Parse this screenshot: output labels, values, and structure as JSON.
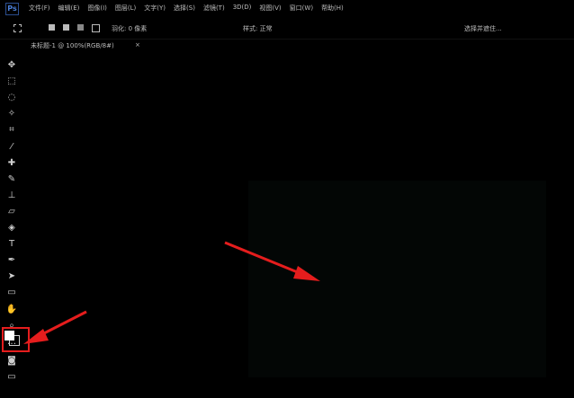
{
  "app": {
    "logo": "Ps"
  },
  "menu": [
    "文件(F)",
    "编辑(E)",
    "图像(I)",
    "图层(L)",
    "文字(Y)",
    "选择(S)",
    "滤镜(T)",
    "3D(D)",
    "视图(V)",
    "窗口(W)",
    "帮助(H)"
  ],
  "options": {
    "feather_label": "羽化: 0 像素",
    "style_label": "样式: 正常",
    "select_mask": "选择并遮住..."
  },
  "document_tab": {
    "title": "未标题-1 @ 100%(RGB/8#)",
    "close": "×"
  },
  "colors": {
    "highlight": "#e51d1d",
    "arrow": "#e51d1d",
    "canvas": "#030605",
    "foreground": "#ffffff"
  },
  "tools": [
    {
      "name": "move-tool",
      "glyph": "✥"
    },
    {
      "name": "marquee-tool",
      "glyph": "⬚"
    },
    {
      "name": "lasso-tool",
      "glyph": "◌"
    },
    {
      "name": "magic-wand-tool",
      "glyph": "✧"
    },
    {
      "name": "crop-tool",
      "glyph": "⌗"
    },
    {
      "name": "eyedropper-tool",
      "glyph": "⁄"
    },
    {
      "name": "healing-tool",
      "glyph": "✚"
    },
    {
      "name": "brush-tool",
      "glyph": "✎"
    },
    {
      "name": "stamp-tool",
      "glyph": "⊥"
    },
    {
      "name": "eraser-tool",
      "glyph": "▱"
    },
    {
      "name": "gradient-tool",
      "glyph": "◈"
    },
    {
      "name": "type-tool",
      "glyph": "T"
    },
    {
      "name": "pen-tool",
      "glyph": "✒"
    },
    {
      "name": "path-select-tool",
      "glyph": "➤"
    },
    {
      "name": "shape-tool",
      "glyph": "▭"
    },
    {
      "name": "hand-tool",
      "glyph": "✋"
    },
    {
      "name": "zoom-tool",
      "glyph": "⌕"
    },
    {
      "name": "more-tools",
      "glyph": "…"
    }
  ],
  "bottom_tools": [
    {
      "name": "quick-mask-button",
      "glyph": "◙"
    },
    {
      "name": "screen-mode-button",
      "glyph": "▭"
    }
  ]
}
